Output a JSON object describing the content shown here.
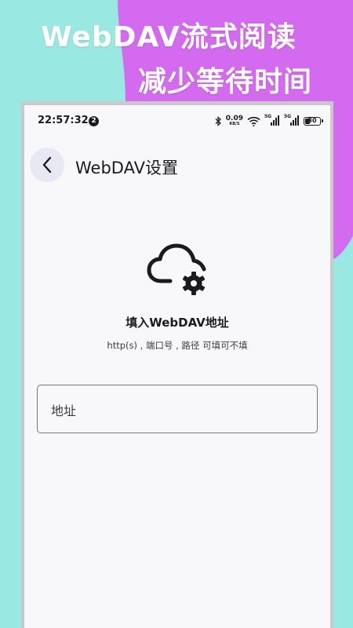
{
  "promo": {
    "line1": "WebDAV流式阅读",
    "line2": "减少等待时间"
  },
  "colors": {
    "background": "#99E8E1",
    "accent_purple": "#D46AF0",
    "screen_bg": "#F8F8FB",
    "back_button_bg": "#E7E8F4"
  },
  "status_bar": {
    "time": "22:57:32",
    "notification_count": "2",
    "net_speed_value": "0.09",
    "net_speed_unit": "KB/S",
    "signal1_tag": "5G",
    "signal2_tag": "5G",
    "battery": "30",
    "icons": [
      "bluetooth-icon",
      "wifi-icon",
      "signal-icon",
      "signal-icon",
      "battery-icon"
    ]
  },
  "app_bar": {
    "back_icon": "chevron-left-icon",
    "title": "WebDAV设置"
  },
  "content": {
    "icon": "cloud-settings-icon",
    "heading": "填入WebDAV地址",
    "subheading": "http(s) , 端口号 , 路径 可填可不填",
    "address_field": {
      "placeholder": "地址",
      "value": ""
    }
  }
}
